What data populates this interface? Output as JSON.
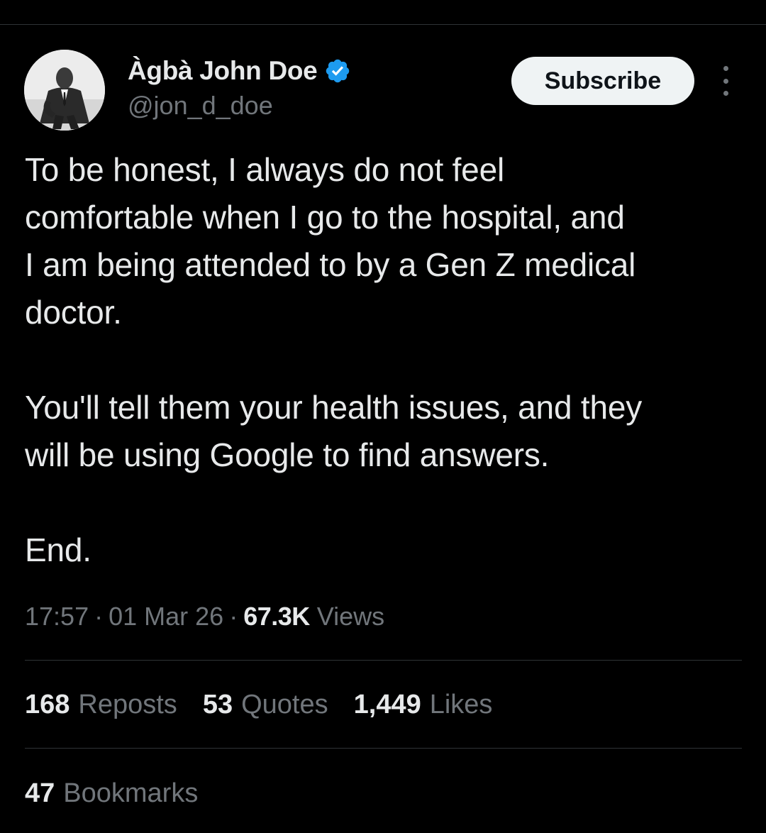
{
  "author": {
    "display_name": "Àgbà John Doe",
    "handle": "@jon_d_doe",
    "verified": true,
    "verified_color": "#1d9bf0"
  },
  "header": {
    "subscribe_label": "Subscribe",
    "more_icon": "more-vertical-icon"
  },
  "tweet": {
    "paragraphs": [
      "To be honest, I always do not feel\ncomfortable when I go to the hospital, and\nI am being attended to by a Gen Z medical\ndoctor.",
      "You'll tell them your health issues, and they\nwill be using Google to find answers.",
      "End."
    ]
  },
  "meta": {
    "time": "17:57",
    "separator": "·",
    "date": "01 Mar 26",
    "views_count": "67.3K",
    "views_label": "Views"
  },
  "stats": {
    "reposts_count": "168",
    "reposts_label": "Reposts",
    "quotes_count": "53",
    "quotes_label": "Quotes",
    "likes_count": "1,449",
    "likes_label": "Likes",
    "bookmarks_count": "47",
    "bookmarks_label": "Bookmarks"
  },
  "colors": {
    "background": "#000000",
    "primary_text": "#e7e9ea",
    "secondary_text": "#71767b",
    "divider": "#2f3336",
    "button_bg": "#eff3f4"
  }
}
